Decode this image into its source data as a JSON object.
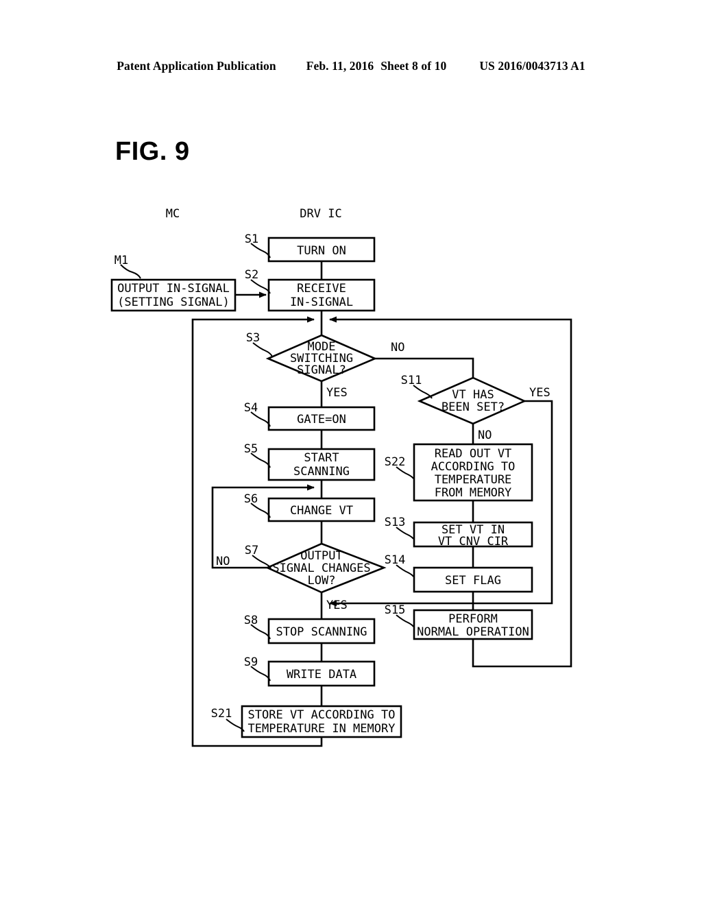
{
  "header": {
    "left": "Patent Application Publication",
    "date": "Feb. 11, 2016",
    "sheet": "Sheet 8 of 10",
    "patent_number": "US 2016/0043713 A1"
  },
  "figure": {
    "title": "FIG. 9",
    "column_headings": [
      {
        "id": "col-mc",
        "label": "MC"
      },
      {
        "id": "col-drv",
        "label": "DRV IC"
      }
    ]
  },
  "chart_data": {
    "type": "diagram",
    "title": "FIG. 9",
    "nodes": [
      {
        "id": "M1",
        "step": "M1",
        "shape": "process",
        "lines": [
          "OUTPUT IN-SIGNAL",
          "(SETTING SIGNAL)"
        ]
      },
      {
        "id": "S1",
        "step": "S1",
        "shape": "process",
        "lines": [
          "TURN ON"
        ]
      },
      {
        "id": "S2",
        "step": "S2",
        "shape": "process",
        "lines": [
          "RECEIVE",
          "IN-SIGNAL"
        ]
      },
      {
        "id": "S3",
        "step": "S3",
        "shape": "decision",
        "lines": [
          "MODE",
          "SWITCHING",
          "SIGNAL?"
        ]
      },
      {
        "id": "S4",
        "step": "S4",
        "shape": "process",
        "lines": [
          "GATE=ON"
        ]
      },
      {
        "id": "S5",
        "step": "S5",
        "shape": "process",
        "lines": [
          "START",
          "SCANNING"
        ]
      },
      {
        "id": "S6",
        "step": "S6",
        "shape": "process",
        "lines": [
          "CHANGE VT"
        ]
      },
      {
        "id": "S7",
        "step": "S7",
        "shape": "decision",
        "lines": [
          "OUTPUT",
          "SIGNAL CHANGES",
          "LOW?"
        ]
      },
      {
        "id": "S8",
        "step": "S8",
        "shape": "process",
        "lines": [
          "STOP SCANNING"
        ]
      },
      {
        "id": "S9",
        "step": "S9",
        "shape": "process",
        "lines": [
          "WRITE DATA"
        ]
      },
      {
        "id": "S21",
        "step": "S21",
        "shape": "process",
        "lines": [
          "STORE VT ACCORDING TO",
          "TEMPERATURE IN MEMORY"
        ]
      },
      {
        "id": "S11",
        "step": "S11",
        "shape": "decision",
        "lines": [
          "VT HAS",
          "BEEN SET?"
        ]
      },
      {
        "id": "S22",
        "step": "S22",
        "shape": "process",
        "lines": [
          "READ OUT VT",
          "ACCORDING TO",
          "TEMPERATURE",
          "FROM MEMORY"
        ]
      },
      {
        "id": "S13",
        "step": "S13",
        "shape": "process",
        "lines": [
          "SET VT IN",
          "VT CNV CIR"
        ]
      },
      {
        "id": "S14",
        "step": "S14",
        "shape": "process",
        "lines": [
          "SET FLAG"
        ]
      },
      {
        "id": "S15",
        "step": "S15",
        "shape": "process",
        "lines": [
          "PERFORM",
          "NORMAL OPERATION"
        ]
      }
    ],
    "branch_labels": [
      {
        "id": "s3-no",
        "from": "S3",
        "label": "NO"
      },
      {
        "id": "s3-yes",
        "from": "S3",
        "label": "YES"
      },
      {
        "id": "s11-yes",
        "from": "S11",
        "label": "YES"
      },
      {
        "id": "s11-no",
        "from": "S11",
        "label": "NO"
      },
      {
        "id": "s7-no",
        "from": "S7",
        "label": "NO"
      },
      {
        "id": "s7-yes",
        "from": "S7",
        "label": "YES"
      }
    ],
    "edges": [
      {
        "from": "S1",
        "to": "S3",
        "label": ""
      },
      {
        "from": "M1",
        "to": "S2",
        "label": ""
      },
      {
        "from": "S2",
        "to": "S3",
        "label": ""
      },
      {
        "from": "S3",
        "to": "S4",
        "label": "YES"
      },
      {
        "from": "S3",
        "to": "S11",
        "label": "NO"
      },
      {
        "from": "S4",
        "to": "S5",
        "label": ""
      },
      {
        "from": "S5",
        "to": "S6",
        "label": ""
      },
      {
        "from": "S6",
        "to": "S7",
        "label": ""
      },
      {
        "from": "S7",
        "to": "S6",
        "label": "NO"
      },
      {
        "from": "S7",
        "to": "S8",
        "label": "YES"
      },
      {
        "from": "S8",
        "to": "S9",
        "label": ""
      },
      {
        "from": "S9",
        "to": "S21",
        "label": ""
      },
      {
        "from": "S21",
        "to": "S3",
        "label": ""
      },
      {
        "from": "S11",
        "to": "S22",
        "label": "NO"
      },
      {
        "from": "S11",
        "to": "S15",
        "label": "YES"
      },
      {
        "from": "S22",
        "to": "S13",
        "label": ""
      },
      {
        "from": "S13",
        "to": "S14",
        "label": ""
      },
      {
        "from": "S14",
        "to": "S15",
        "label": ""
      },
      {
        "from": "S15",
        "to": "S3",
        "label": ""
      }
    ]
  }
}
